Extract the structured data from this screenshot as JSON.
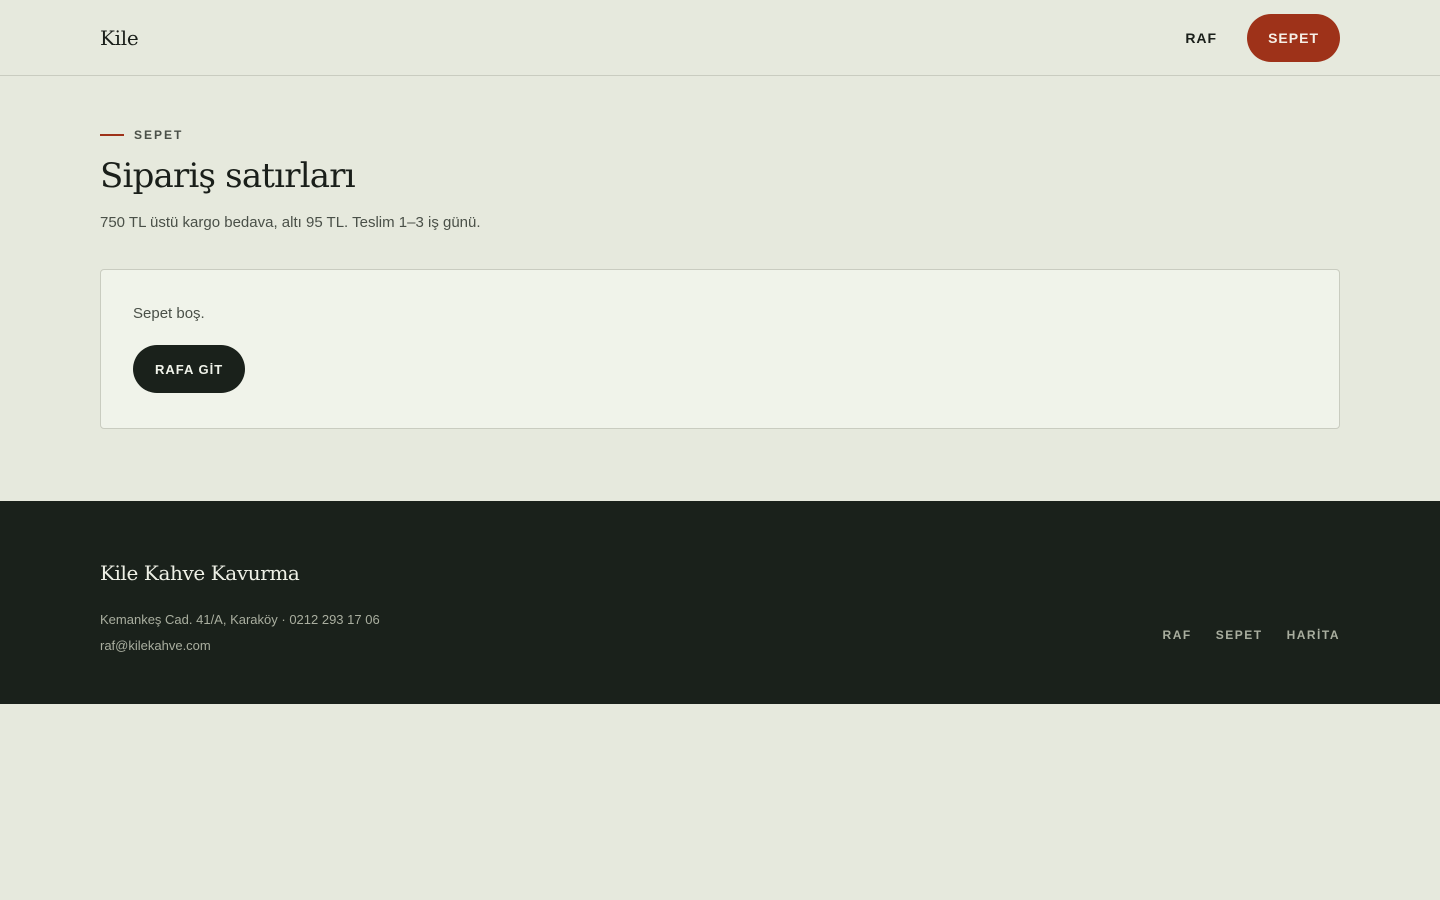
{
  "header": {
    "logo": "Kile",
    "nav": {
      "shelf_label": "RAF",
      "cart_label": "SEPET"
    }
  },
  "main": {
    "eyebrow": "SEPET",
    "title": "Sipariş satırları",
    "subtitle": "750 TL üstü kargo bedava, altı 95 TL. Teslim 1–3 iş günü.",
    "cart": {
      "empty_text": "Sepet boş.",
      "button_label": "RAFA GİT"
    }
  },
  "footer": {
    "brand": "Kile Kahve Kavurma",
    "address_line": "Kemankeş Cad. 41/A, Karaköy · 0212 293 17 06",
    "email": "raf@kilekahve.com",
    "links": [
      "RAF",
      "SEPET",
      "HARİTA"
    ]
  },
  "colors": {
    "accent": "#9e3219",
    "dark": "#1a211b",
    "background": "#e6e9dd",
    "card": "#f0f3ea"
  }
}
